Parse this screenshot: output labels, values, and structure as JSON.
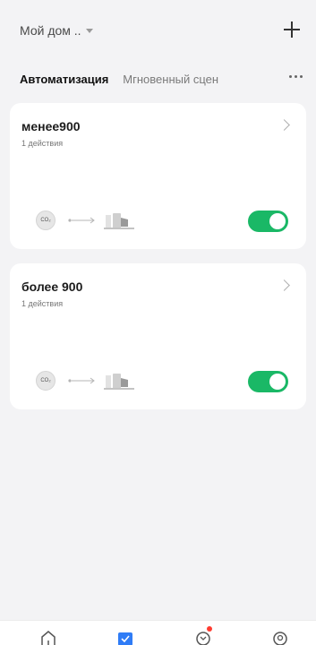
{
  "header": {
    "home_label": "Мой дом ..",
    "add_icon": "plus-icon"
  },
  "tabs": [
    {
      "label": "Автоматизация",
      "active": true
    },
    {
      "label": "Мгновенный сцен",
      "active": false
    }
  ],
  "more_icon": "ellipsis-icon",
  "cards": [
    {
      "title": "менее900",
      "subtitle": "1 действия",
      "condition_icon_label": "CO₂",
      "enabled": true
    },
    {
      "title": "более 900",
      "subtitle": "1 действия",
      "condition_icon_label": "CO₂",
      "enabled": true
    }
  ],
  "colors": {
    "toggle_on": "#1ab866",
    "nav_active": "#2f7cf6",
    "badge": "#ff3b30",
    "background": "#f3f3f5"
  },
  "bottom_nav": {
    "items": [
      {
        "icon": "home-icon",
        "active": false
      },
      {
        "icon": "automation-checkbox-icon",
        "active": true
      },
      {
        "icon": "explore-icon",
        "active": false,
        "badge": true
      },
      {
        "icon": "profile-icon",
        "active": false
      }
    ]
  }
}
